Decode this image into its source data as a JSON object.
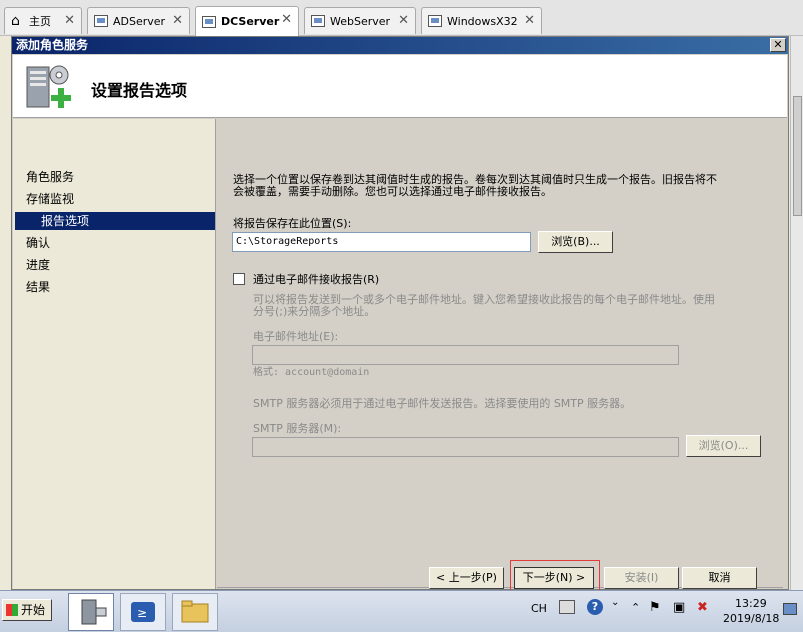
{
  "vm_tabs": [
    {
      "label": "主页",
      "active": false
    },
    {
      "label": "ADServer",
      "active": false
    },
    {
      "label": "DCServer",
      "active": true
    },
    {
      "label": "WebServer",
      "active": false
    },
    {
      "label": "WindowsX32",
      "active": false
    }
  ],
  "window": {
    "title": "添加角色服务",
    "close_label": "✕",
    "header_title": "设置报告选项"
  },
  "sidebar": {
    "items": [
      {
        "label": "角色服务",
        "selected": false
      },
      {
        "label": "存储监视",
        "selected": false
      },
      {
        "label": "报告选项",
        "selected": true
      },
      {
        "label": "确认",
        "selected": false
      },
      {
        "label": "进度",
        "selected": false
      },
      {
        "label": "结果",
        "selected": false
      }
    ]
  },
  "content": {
    "description_line1": "选择一个位置以保存卷到达其阈值时生成的报告。卷每次到达其阈值时只生成一个报告。旧报告将不",
    "description_line2": "会被覆盖，需要手动删除。您也可以选择通过电子邮件接收报告。",
    "save_location_label": "将报告保存在此位置(S):",
    "save_location_value": "C:\\StorageReports",
    "browse_label": "浏览(B)...",
    "email_checkbox_label": "通过电子邮件接收报告(R)",
    "email_desc_line1": "可以将报告发送到一个或多个电子邮件地址。键入您希望接收此报告的每个电子邮件地址。使用",
    "email_desc_line2": "分号(;)来分隔多个地址。",
    "email_address_label": "电子邮件地址(E):",
    "email_format_hint": "格式: account@domain",
    "smtp_desc": "SMTP 服务器必须用于通过电子邮件发送报告。选择要使用的 SMTP 服务器。",
    "smtp_label": "SMTP 服务器(M):",
    "smtp_browse_label": "浏览(O)..."
  },
  "footer": {
    "prev_label": "< 上一步(P)",
    "next_label": "下一步(N) >",
    "install_label": "安装(I)",
    "cancel_label": "取消"
  },
  "taskbar": {
    "start_label": "开始",
    "language": "CH",
    "time": "13:29",
    "date": "2019/8/18"
  }
}
